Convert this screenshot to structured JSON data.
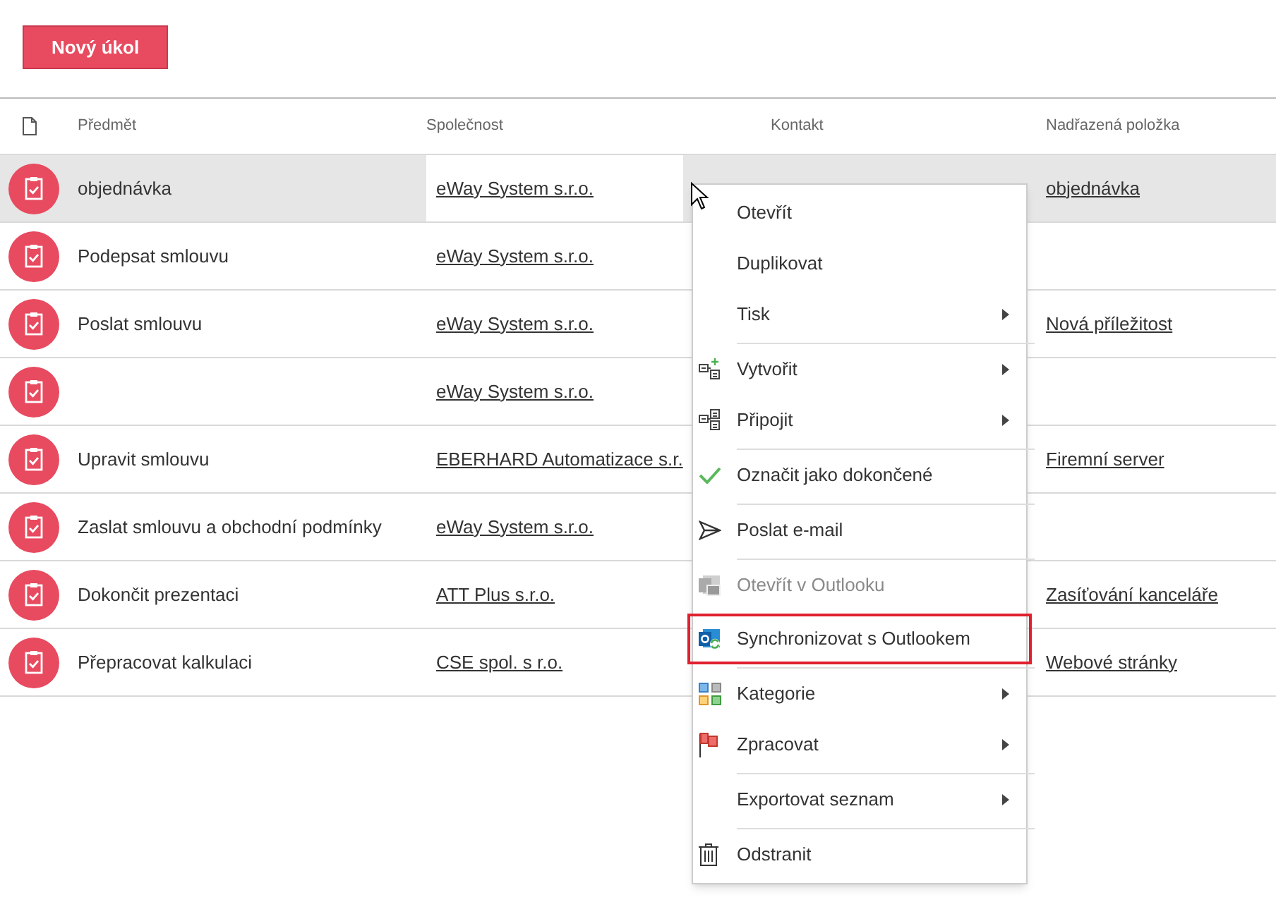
{
  "new_button": "Nový úkol",
  "table": {
    "columns": [
      "Předmět",
      "Společnost",
      "Kontakt",
      "Nadřazená položka"
    ],
    "rows": [
      {
        "subject": "objednávka",
        "company": "eWay System s.r.o.",
        "parent": "objednávka",
        "selected": true
      },
      {
        "subject": "Podepsat smlouvu",
        "company": "eWay System s.r.o.",
        "selected": false
      },
      {
        "subject": "Poslat smlouvu",
        "company": "eWay System s.r.o.",
        "parent": "Nová příležitost",
        "selected": false
      },
      {
        "company": "eWay System s.r.o.",
        "selected": false
      },
      {
        "subject": "Upravit smlouvu",
        "company": "EBERHARD Automatizace s.r.",
        "parent": "Firemní server",
        "selected": false
      },
      {
        "subject": "Zaslat smlouvu a obchodní podmínky",
        "company": "eWay System s.r.o.",
        "selected": false
      },
      {
        "subject": "Dokončit prezentaci",
        "company": "ATT Plus s.r.o.",
        "parent": "Zasíťování kanceláře",
        "selected": false
      },
      {
        "subject": "Přepracovat kalkulaci",
        "company": "CSE spol. s r.o.",
        "parent": "Webové stránky",
        "selected": false
      }
    ]
  },
  "context_menu": [
    {
      "label": "Otevřít",
      "submenu": false,
      "separator_before": false,
      "disabled": false,
      "highlighted": false
    },
    {
      "label": "Duplikovat",
      "submenu": false,
      "separator_before": false,
      "disabled": false,
      "highlighted": false
    },
    {
      "label": "Tisk",
      "submenu": true,
      "separator_before": false,
      "disabled": false,
      "highlighted": false
    },
    {
      "label": "Vytvořit",
      "kind": "create",
      "submenu": true,
      "separator_before": true,
      "disabled": false,
      "highlighted": false
    },
    {
      "label": "Připojit",
      "kind": "attach",
      "submenu": true,
      "separator_before": false,
      "disabled": false,
      "highlighted": false
    },
    {
      "label": "Označit jako dokončené",
      "kind": "check",
      "submenu": false,
      "separator_before": true,
      "disabled": false,
      "highlighted": false
    },
    {
      "label": "Poslat e-mail",
      "kind": "send",
      "submenu": false,
      "separator_before": true,
      "disabled": false,
      "highlighted": false
    },
    {
      "label": "Otevřít v Outlooku",
      "kind": "outlook-open",
      "submenu": false,
      "separator_before": true,
      "disabled": true,
      "highlighted": false
    },
    {
      "label": "Synchronizovat s Outlookem",
      "kind": "outlook-sync",
      "submenu": false,
      "separator_before": false,
      "disabled": false,
      "highlighted": true
    },
    {
      "label": "Kategorie",
      "kind": "categories",
      "submenu": true,
      "separator_before": true,
      "disabled": false,
      "highlighted": false
    },
    {
      "label": "Zpracovat",
      "kind": "flag",
      "submenu": true,
      "separator_before": false,
      "disabled": false,
      "highlighted": false
    },
    {
      "label": "Exportovat seznam",
      "submenu": true,
      "separator_before": true,
      "disabled": false,
      "highlighted": false
    },
    {
      "label": "Odstranit",
      "kind": "trash",
      "submenu": false,
      "separator_before": true,
      "disabled": false,
      "highlighted": false
    }
  ]
}
